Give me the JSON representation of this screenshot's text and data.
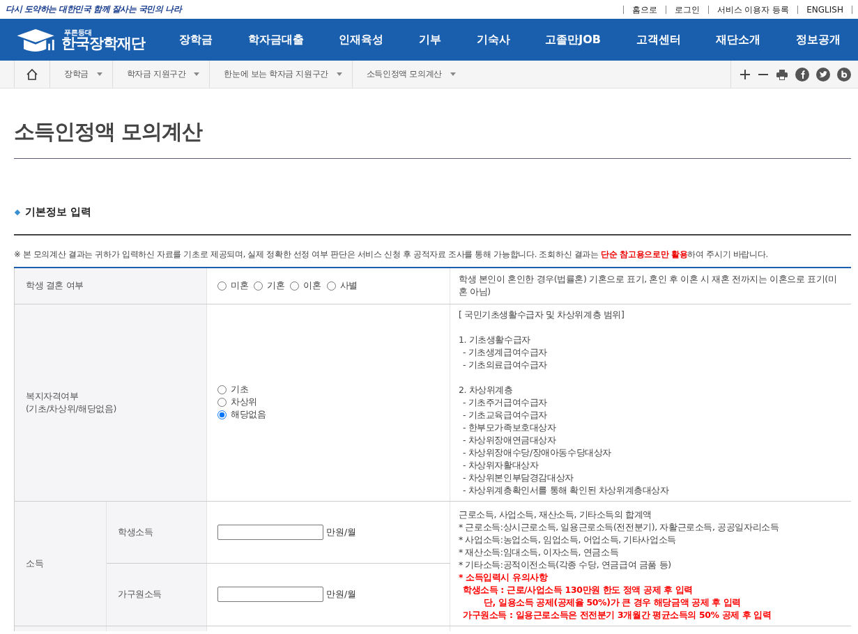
{
  "slogan": "다시 도약하는 대한민국 함께 잘사는 국민의 나라",
  "top_links": [
    "홈으로",
    "로그인",
    "서비스 이용자 등록",
    "ENGLISH"
  ],
  "logo": {
    "tagline": "푸른등대",
    "name": "한국장학재단"
  },
  "nav": [
    "장학금",
    "학자금대출",
    "인재육성",
    "기부",
    "기숙사",
    "고졸만JOB",
    "고객센터",
    "재단소개",
    "정보공개"
  ],
  "breadcrumb": [
    "장학금",
    "학자금 지원구간",
    "한눈에 보는 학자금 지원구간",
    "소득인정액 모의계산"
  ],
  "page_title": "소득인정액 모의계산",
  "section_title": "기본정보 입력",
  "notice": "※ 본 모의계산 결과는 귀하가 입력하신 자료를 기초로 제공되며, 실제 정확한 선정 여부 판단은 서비스 신청 후 공적자료 조사를 통해 가능합니다. 조회하신 결과는 **단순 참고용으로만 활용**하여 주시기 바랍니다.",
  "form": {
    "rows": [
      {
        "kind": "radio-inline",
        "label": "학생 결혼 여부",
        "options": [
          {
            "label": "미혼",
            "selected": false
          },
          {
            "label": "기혼",
            "selected": false
          },
          {
            "label": "이혼",
            "selected": false
          },
          {
            "label": "사별",
            "selected": false
          }
        ],
        "description": [
          [
            {
              "text": "학생 본인이 혼인한 경우(법률혼) 기혼으로 표기, 혼인 후 이혼 시 재혼 전까지는 이혼으로 표기(미혼 아님)",
              "emphasis": false
            }
          ]
        ]
      },
      {
        "kind": "radio-stack",
        "label": "복지자격여부",
        "label_note": "(기초/차상위/해당없음)",
        "options": [
          {
            "label": "기초",
            "selected": false
          },
          {
            "label": "차상위",
            "selected": false
          },
          {
            "label": "해당없음",
            "selected": true
          }
        ],
        "description": [
          [
            {
              "text": "[ 국민기초생활수급자 및 차상위계층 범위]",
              "emphasis": false
            }
          ],
          [
            {
              "text": "1. 기초생활수급자",
              "emphasis": false,
              "children": [
                {
                  "text": "- 기초생계급여수급자",
                  "emphasis": false
                },
                {
                  "text": "- 기초의료급여수급자",
                  "emphasis": false
                }
              ]
            }
          ],
          [
            {
              "text": "2. 차상위계층",
              "emphasis": false,
              "children": [
                {
                  "text": "- 기초주거급여수급자",
                  "emphasis": false
                },
                {
                  "text": "- 기초교육급여수급자",
                  "emphasis": false
                },
                {
                  "text": "- 한부모가족보호대상자",
                  "emphasis": false
                },
                {
                  "text": "- 차상위장애연금대상자",
                  "emphasis": false
                },
                {
                  "text": "- 차상위장애수당/장애아동수당대상자",
                  "emphasis": false
                },
                {
                  "text": "- 차상위자활대상자",
                  "emphasis": false
                },
                {
                  "text": "- 차상위본인부담경감대상자",
                  "emphasis": false
                },
                {
                  "text": "- 차상위계층확인서를 통해 확인된 차상위계층대상자",
                  "emphasis": false
                }
              ]
            }
          ]
        ]
      },
      {
        "kind": "income",
        "label": "소득",
        "fields": [
          {
            "label": "학생소득",
            "unit": "만원/월"
          },
          {
            "label": "가구원소득",
            "unit": "만원/월"
          }
        ],
        "description": [
          [
            {
              "text": "근로소득, 사업소득, 재산소득, 기타소득의 합계액",
              "emphasis": false
            },
            {
              "text": "* 근로소득:상시근로소득, 일용근로소득(전전분기), 자활근로소득, 공공일자리소득",
              "emphasis": false
            },
            {
              "text": "* 사업소득:농업소득, 임업소득, 어업소득, 기타사업소득",
              "emphasis": false
            },
            {
              "text": "* 재산소득:임대소득, 이자소득, 연금소득",
              "emphasis": false
            },
            {
              "text": "* 기타소득:공적이전소득(각종 수당, 연금급여 금품 등)",
              "emphasis": false
            },
            {
              "text": "* 소득입력시 유의사항",
              "emphasis": true,
              "children": [
                {
                  "text": "학생소득 : 근로/사업소득 130만원 한도 정액 공제 후 입력",
                  "emphasis": true,
                  "children": [
                    {
                      "text": "단, 일용소득 공제(공제율 50%)가 큰 경우 해당금액 공제 후 입력",
                      "emphasis": true
                    }
                  ]
                },
                {
                  "text": "가구원소득 : 일용근로소득은 전전분기 3개월간 평균소득의 50% 공제 후 입력",
                  "emphasis": true
                }
              ]
            }
          ]
        ]
      }
    ]
  }
}
